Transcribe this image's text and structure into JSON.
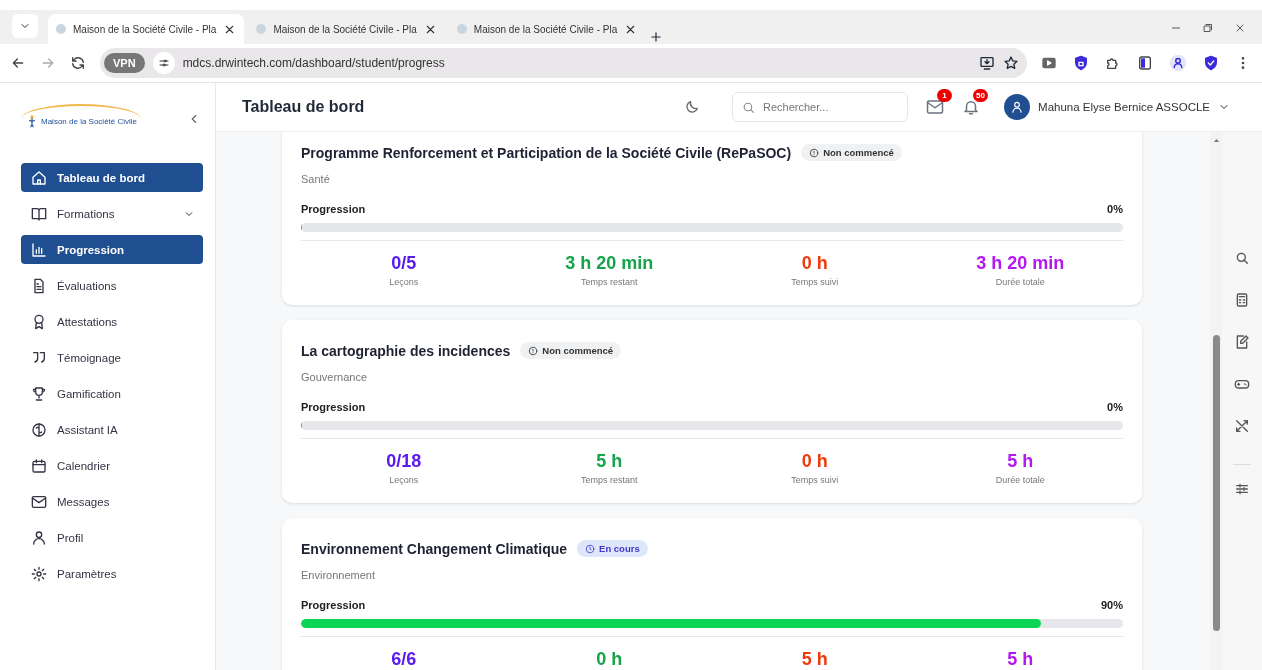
{
  "browser": {
    "tabs": [
      {
        "title": "Maison de la Société Civile - Pla",
        "selected": true
      },
      {
        "title": "Maison de la Société Civile - Pla",
        "selected": false
      },
      {
        "title": "Maison de la Société Civile - Pla",
        "selected": false
      }
    ],
    "vpn_label": "VPN",
    "url": "mdcs.drwintech.com/dashboard/student/progress"
  },
  "sidebar": {
    "logo_text": "Maison de la Société Civile",
    "items": [
      {
        "label": "Tableau de bord",
        "selected": true
      },
      {
        "label": "Formations",
        "selected": false,
        "expandable": true
      },
      {
        "label": "Progression",
        "selected": true
      },
      {
        "label": "Évaluations",
        "selected": false
      },
      {
        "label": "Attestations",
        "selected": false
      },
      {
        "label": "Témoignage",
        "selected": false
      },
      {
        "label": "Gamification",
        "selected": false
      },
      {
        "label": "Assistant IA",
        "selected": false
      },
      {
        "label": "Calendrier",
        "selected": false
      },
      {
        "label": "Messages",
        "selected": false
      },
      {
        "label": "Profil",
        "selected": false
      },
      {
        "label": "Paramètres",
        "selected": false
      }
    ]
  },
  "header": {
    "title": "Tableau de bord",
    "search_placeholder": "Rechercher...",
    "mail_count": "1",
    "notification_count": "50",
    "user_name": "Mahuna Elyse Bernice ASSOCLE"
  },
  "courses": [
    {
      "title": "Programme Renforcement et Participation de la Société Civile (RePaSOC)",
      "status": "Non commencé",
      "in_progress": false,
      "category": "Santé",
      "progress_label": "Progression",
      "progress_text": "0%",
      "level": 0,
      "stats": [
        {
          "value": "0/5",
          "label": "Leçons",
          "color": "#5b1cf0"
        },
        {
          "value": "3 h 20 min",
          "label": "Temps restant",
          "color": "#16a34a"
        },
        {
          "value": "0 h",
          "label": "Temps suivi",
          "color": "#ef3a0c"
        },
        {
          "value": "3 h 20 min",
          "label": "Durée totale",
          "color": "#b517f0"
        }
      ]
    },
    {
      "title": "La cartographie des incidences",
      "status": "Non commencé",
      "in_progress": false,
      "category": "Gouvernance",
      "progress_label": "Progression",
      "progress_text": "0%",
      "level": 0,
      "stats": [
        {
          "value": "0/18",
          "label": "Leçons",
          "color": "#5b1cf0"
        },
        {
          "value": "5 h",
          "label": "Temps restant",
          "color": "#16a34a"
        },
        {
          "value": "0 h",
          "label": "Temps suivi",
          "color": "#ef3a0c"
        },
        {
          "value": "5 h",
          "label": "Durée totale",
          "color": "#b517f0"
        }
      ]
    },
    {
      "title": "Environnement Changement Climatique",
      "status": "En cours",
      "in_progress": true,
      "category": "Environnement",
      "progress_label": "Progression",
      "progress_text": "90%",
      "level": 0.9,
      "stats": [
        {
          "value": "6/6",
          "color": "#5b1cf0"
        },
        {
          "value": "0 h",
          "color": "#16a34a"
        },
        {
          "value": "5 h",
          "color": "#ef3a0c"
        },
        {
          "value": "5 h",
          "color": "#b517f0"
        }
      ]
    }
  ]
}
